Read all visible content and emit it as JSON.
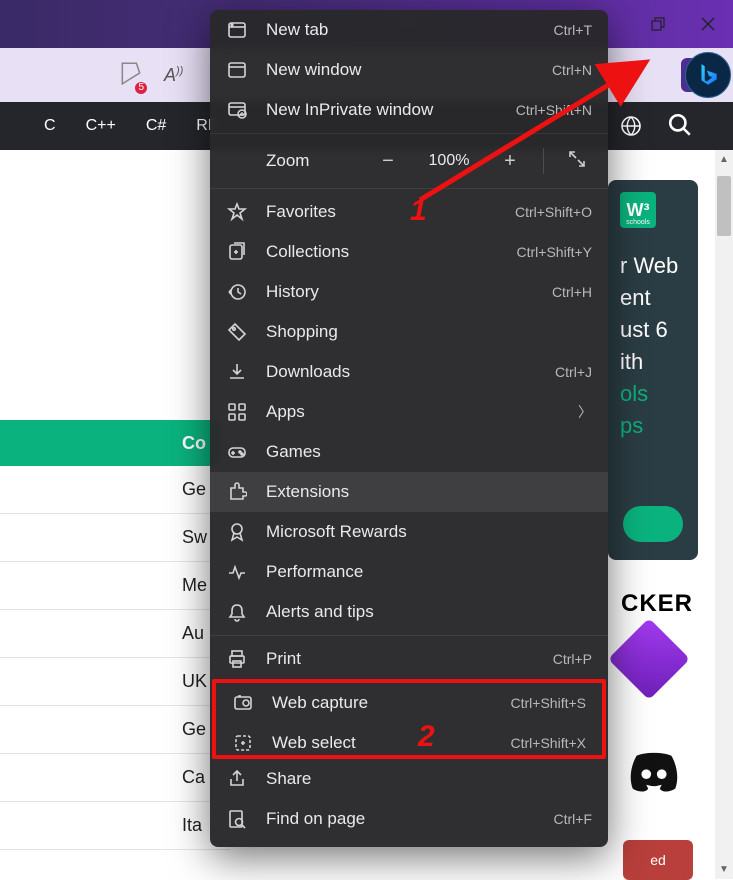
{
  "window": {
    "maximize_restore": "❐",
    "close": "✕"
  },
  "toolbar": {
    "collections_badge": "5",
    "read_aloud": "A))",
    "more": "···"
  },
  "bing_logo": "b",
  "sitebar": {
    "items": [
      "C",
      "C++",
      "C#",
      "RE"
    ]
  },
  "ad": {
    "logo": "W³",
    "logo_sub": "schools",
    "lines": [
      "r Web",
      "ent",
      "ust 6",
      "ith",
      "ols",
      "ps"
    ]
  },
  "picker_label": "CKER",
  "red_button": "ed",
  "list": {
    "header": "Co",
    "rows": [
      "Ge",
      "Sw",
      "Me",
      "Au",
      "UK",
      "Ge",
      "Ca",
      "Ita"
    ]
  },
  "menu": {
    "new_tab": {
      "label": "New tab",
      "shortcut": "Ctrl+T"
    },
    "new_window": {
      "label": "New window",
      "shortcut": "Ctrl+N"
    },
    "new_inprivate": {
      "label": "New InPrivate window",
      "shortcut": "Ctrl+Shift+N"
    },
    "zoom": {
      "label": "Zoom",
      "value": "100%"
    },
    "favorites": {
      "label": "Favorites",
      "shortcut": "Ctrl+Shift+O"
    },
    "collections": {
      "label": "Collections",
      "shortcut": "Ctrl+Shift+Y"
    },
    "history": {
      "label": "History",
      "shortcut": "Ctrl+H"
    },
    "shopping": {
      "label": "Shopping"
    },
    "downloads": {
      "label": "Downloads",
      "shortcut": "Ctrl+J"
    },
    "apps": {
      "label": "Apps"
    },
    "games": {
      "label": "Games"
    },
    "extensions": {
      "label": "Extensions"
    },
    "rewards": {
      "label": "Microsoft Rewards"
    },
    "performance": {
      "label": "Performance"
    },
    "alerts": {
      "label": "Alerts and tips"
    },
    "print": {
      "label": "Print",
      "shortcut": "Ctrl+P"
    },
    "web_capture": {
      "label": "Web capture",
      "shortcut": "Ctrl+Shift+S"
    },
    "web_select": {
      "label": "Web select",
      "shortcut": "Ctrl+Shift+X"
    },
    "share": {
      "label": "Share"
    },
    "find": {
      "label": "Find on page",
      "shortcut": "Ctrl+F"
    }
  },
  "annotations": {
    "one": "1",
    "two": "2"
  }
}
